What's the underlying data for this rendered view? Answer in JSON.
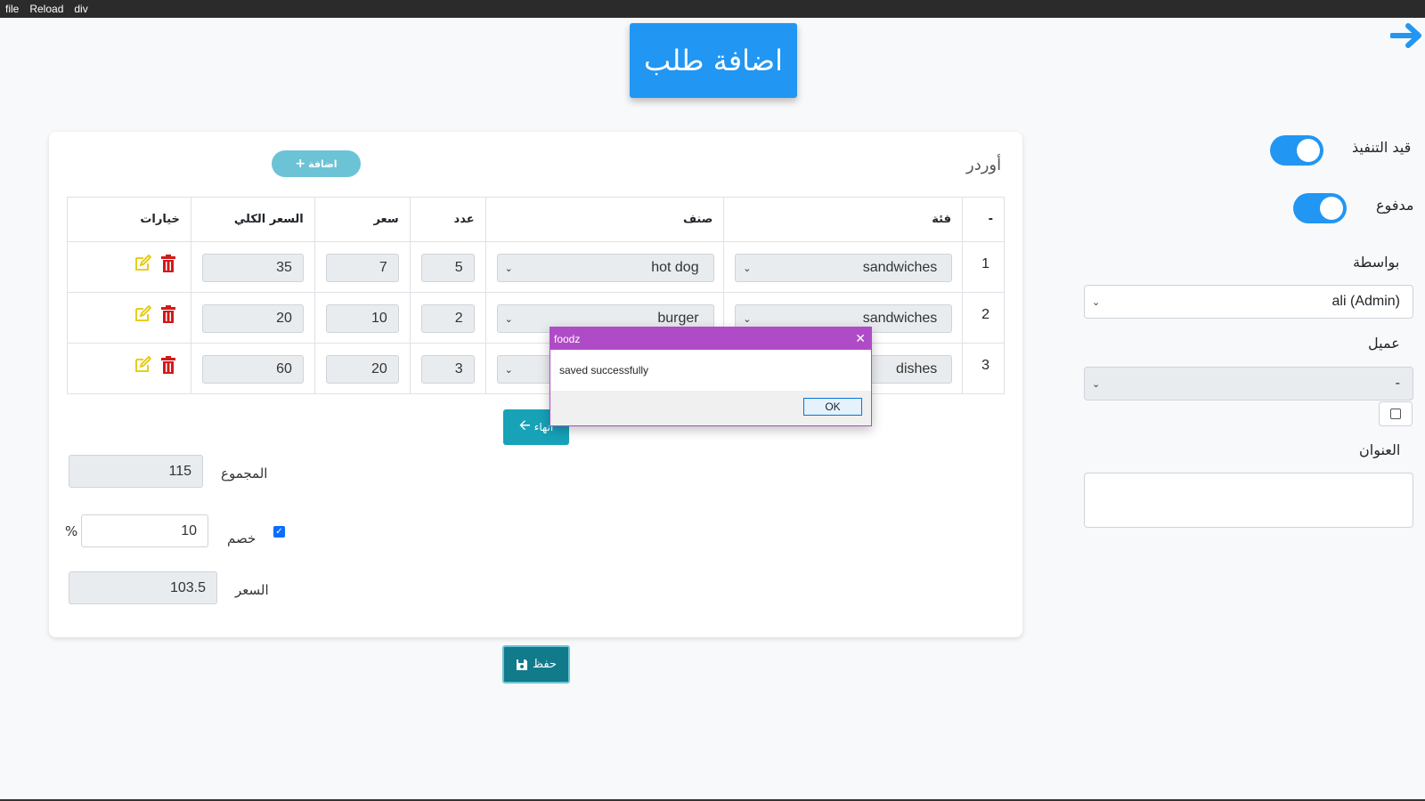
{
  "menubar": {
    "items": [
      "file",
      "Reload",
      "div"
    ]
  },
  "page_title": "اضافة طلب",
  "side": {
    "in_progress_label": "قيد التنفيذ",
    "paid_label": "مدفوع",
    "by_label": "بواسطة",
    "by_value": "ali (Admin)",
    "client_label": "عميل",
    "client_value": "-",
    "address_label": "العنوان"
  },
  "card": {
    "title": "أوردر",
    "add_label": "اضافة",
    "columns": [
      "-",
      "فئة",
      "صنف",
      "عدد",
      "سعر",
      "السعر الكلي",
      "خيارات"
    ],
    "rows": [
      {
        "num": "1",
        "category": "sandwiches",
        "item": "hot dog",
        "qty": "5",
        "price": "7",
        "total": "35"
      },
      {
        "num": "2",
        "category": "sandwiches",
        "item": "burger",
        "qty": "2",
        "price": "10",
        "total": "20"
      },
      {
        "num": "3",
        "category": "dishes",
        "item": "",
        "qty": "3",
        "price": "20",
        "total": "60"
      }
    ],
    "end_label": "انهاء",
    "sum_label": "المجموع",
    "sum_value": "115",
    "discount_label": "خصم",
    "discount_value": "10",
    "percent_sign": "%",
    "price_label": "السعر",
    "price_value": "103.5"
  },
  "save_label": "حفظ",
  "dialog": {
    "title": "foodz",
    "message": "saved successfully",
    "ok_label": "OK"
  },
  "colors": {
    "primary": "#2196f3",
    "dialog": "#b04bc8",
    "info": "#17a2b8"
  }
}
